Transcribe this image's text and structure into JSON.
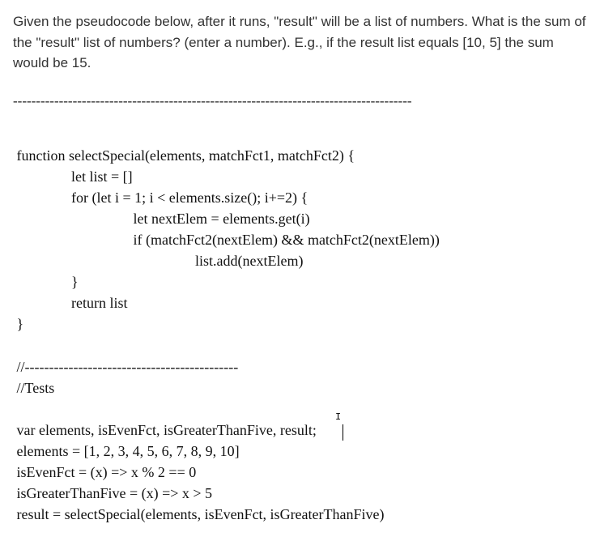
{
  "prompt": "Given the pseudocode below, after it runs, \"result\" will be a list of numbers. What is the sum of the \"result\" list of numbers? (enter a number). E.g., if the result list equals [10, 5] the sum would be 15.",
  "dashes": "---------------------------------------------------------------------------------------",
  "code": {
    "l01": " function selectSpecial(elements, matchFct1, matchFct2) {",
    "l02": "                let list = []",
    "l03": "                for (let i = 1; i < elements.size(); i+=2) {",
    "l04": "                                 let nextElem = elements.get(i)",
    "l05": "                                 if (matchFct2(nextElem) && matchFct2(nextElem))",
    "l06": "                                                  list.add(nextElem)",
    "l07": "                }",
    "l08": "                return list",
    "l09": " }",
    "l10": "",
    "l11": " //--------------------------------------------",
    "l12": " //Tests",
    "l13": "",
    "l14": " var elements, isEvenFct, isGreaterThanFive, result;",
    "l15": " elements = [1, 2, 3, 4, 5, 6, 7, 8, 9, 10]",
    "l16": " isEvenFct = (x) => x % 2 == 0",
    "l17": " isGreaterThanFive = (x) => x > 5",
    "l18": " result = selectSpecial(elements, isEvenFct, isGreaterThanFive)"
  },
  "caret": "I"
}
